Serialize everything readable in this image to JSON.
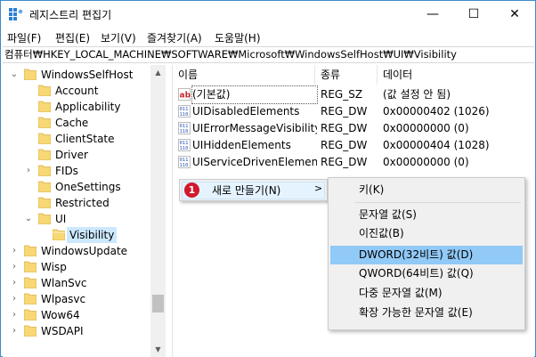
{
  "window": {
    "title": "레지스트리 편집기",
    "minimize": "—",
    "maximize": "☐",
    "close": "✕"
  },
  "menubar": [
    "파일(F)",
    "편집(E)",
    "보기(V)",
    "즐겨찾기(A)",
    "도움말(H)"
  ],
  "address": "컴퓨터₩HKEY_LOCAL_MACHINE₩SOFTWARE₩Microsoft₩WindowsSelfHost₩UI₩Visibility",
  "tree": [
    {
      "label": "WindowsSelfHost",
      "expander": "⌄",
      "depth": 0
    },
    {
      "label": "Account",
      "expander": "",
      "depth": 1
    },
    {
      "label": "Applicability",
      "expander": "",
      "depth": 1
    },
    {
      "label": "Cache",
      "expander": "",
      "depth": 1
    },
    {
      "label": "ClientState",
      "expander": "",
      "depth": 1
    },
    {
      "label": "Driver",
      "expander": "",
      "depth": 1
    },
    {
      "label": "FIDs",
      "expander": "›",
      "depth": 1
    },
    {
      "label": "OneSettings",
      "expander": "",
      "depth": 1
    },
    {
      "label": "Restricted",
      "expander": "",
      "depth": 1
    },
    {
      "label": "UI",
      "expander": "⌄",
      "depth": 1
    },
    {
      "label": "Visibility",
      "expander": "",
      "depth": 2,
      "selected": true
    },
    {
      "label": "WindowsUpdate",
      "expander": "›",
      "depth": 0
    },
    {
      "label": "Wisp",
      "expander": "›",
      "depth": 0
    },
    {
      "label": "WlanSvc",
      "expander": "›",
      "depth": 0
    },
    {
      "label": "Wlpasvc",
      "expander": "›",
      "depth": 0
    },
    {
      "label": "Wow64",
      "expander": "›",
      "depth": 0
    },
    {
      "label": "WSDAPI",
      "expander": "›",
      "depth": 0
    }
  ],
  "columns": {
    "name": "이름",
    "type": "종류",
    "data": "데이터"
  },
  "values": [
    {
      "name": "(기본값)",
      "type": "REG_SZ",
      "data": "(값 설정 안 됨)",
      "icon": "string-value-icon"
    },
    {
      "name": "UIDisabledElements",
      "type": "REG_DW",
      "data": "0x00000402 (1026)",
      "icon": "binary-value-icon"
    },
    {
      "name": "UIErrorMessageVisibility",
      "type": "REG_DW",
      "data": "0x00000000 (0)",
      "icon": "binary-value-icon"
    },
    {
      "name": "UIHiddenElements",
      "type": "REG_DW",
      "data": "0x00000404 (1028)",
      "icon": "binary-value-icon"
    },
    {
      "name": "UIServiceDrivenElement...",
      "type": "REG_DW",
      "data": "0x00000000 (0)",
      "icon": "binary-value-icon"
    }
  ],
  "context_menu": {
    "badge": "1",
    "new_label": "새로 만들기(N)",
    "submenu_arrow": ">"
  },
  "submenu": [
    {
      "label": "키(K)",
      "highlighted": false
    },
    {
      "label": "문자열 값(S)",
      "highlighted": false
    },
    {
      "label": "이진값(B)",
      "highlighted": false
    },
    {
      "label": "DWORD(32비트) 값(D)",
      "highlighted": true
    },
    {
      "label": "QWORD(64비트) 값(Q)",
      "highlighted": false
    },
    {
      "label": "다중 문자열 값(M)",
      "highlighted": false
    },
    {
      "label": "확장 가능한 문자열 값(E)",
      "highlighted": false
    }
  ],
  "colors": {
    "selected_tree": "#cce8ff",
    "submenu_highlight": "#91c9f7",
    "badge": "#d1192b",
    "folder": "#f8d775"
  }
}
